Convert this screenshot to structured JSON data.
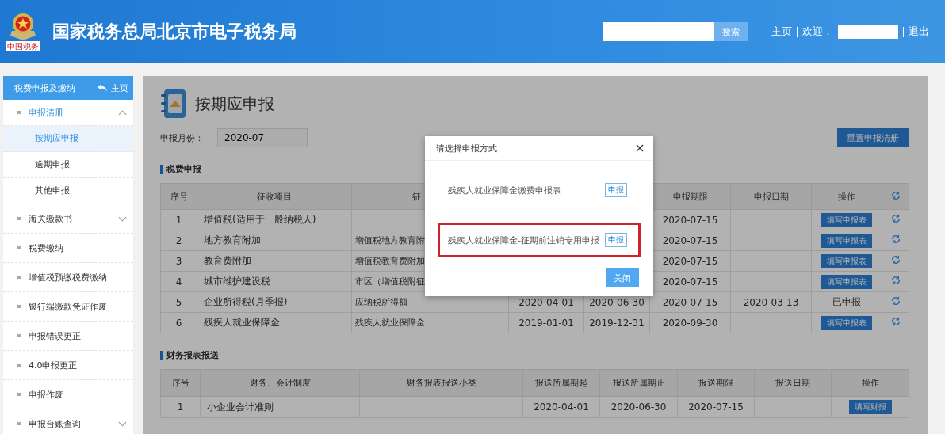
{
  "header": {
    "title": "国家税务总局北京市电子税务局",
    "logo_caption": "中国税务",
    "search": {
      "button": "搜索"
    },
    "links": [
      {
        "label": "主页"
      },
      {
        "label": "欢迎，"
      },
      {
        "label": "退出"
      }
    ]
  },
  "sidebar": {
    "title": "税费申报及缴纳",
    "home": "主页",
    "items": [
      {
        "label": "申报清册",
        "kind": "group",
        "expanded": true,
        "children": [
          {
            "label": "按期应申报",
            "selected": true
          },
          {
            "label": "逾期申报",
            "selected": false
          },
          {
            "label": "其他申报",
            "selected": false
          }
        ]
      },
      {
        "label": "海关缴款书",
        "kind": "group",
        "expanded": false
      },
      {
        "label": "税费缴纳",
        "kind": "link"
      },
      {
        "label": "增值税预缴税费缴纳",
        "kind": "link"
      },
      {
        "label": "银行端缴款凭证作废",
        "kind": "link"
      },
      {
        "label": "申报错误更正",
        "kind": "link"
      },
      {
        "label": "4.0申报更正",
        "kind": "link"
      },
      {
        "label": "申报作废",
        "kind": "link"
      },
      {
        "label": "申报台账查询",
        "kind": "group",
        "expanded": false
      }
    ]
  },
  "page": {
    "title": "按期应申报",
    "month_label": "申报月份：",
    "month_value": "2020-07",
    "reset_button": "重置申报清册"
  },
  "tax_section": {
    "title": "税费申报",
    "columns": [
      {
        "label": "序号"
      },
      {
        "label": "征收项目"
      },
      {
        "label": "征"
      },
      {},
      {},
      {
        "label": "申报期限"
      },
      {
        "label": "申报日期"
      },
      {
        "label": "操作"
      },
      {
        "kind": "refresh"
      }
    ],
    "rows": [
      {
        "no": "1",
        "item": "增值税(适用于一般纳税人)",
        "deadline": "2020-07-15",
        "action": {
          "kind": "button",
          "label": "填写申报表"
        }
      },
      {
        "no": "2",
        "item": "地方教育附加",
        "category": "增值税地方教育附",
        "deadline": "2020-07-15",
        "action": {
          "kind": "button",
          "label": "填写申报表"
        }
      },
      {
        "no": "3",
        "item": "教育费附加",
        "category": "增值税教育费附加",
        "deadline": "2020-07-15",
        "action": {
          "kind": "button",
          "label": "填写申报表"
        }
      },
      {
        "no": "4",
        "item": "城市维护建设税",
        "category": "市区（增值税附征",
        "deadline": "2020-07-15",
        "action": {
          "kind": "button",
          "label": "填写申报表"
        }
      },
      {
        "no": "5",
        "item": "企业所得税(月季报)",
        "category": "应纳税所得额",
        "start": "2020-04-01",
        "end": "2020-06-30",
        "deadline": "2020-07-15",
        "date": "2020-03-13",
        "action": {
          "kind": "text",
          "label": "已申报"
        }
      },
      {
        "no": "6",
        "item": "残疾人就业保障金",
        "category": "残疾人就业保障金",
        "start": "2019-01-01",
        "end": "2019-12-31",
        "deadline": "2020-09-30",
        "action": {
          "kind": "button",
          "label": "填写申报表"
        }
      }
    ]
  },
  "finance_section": {
    "title": "财务报表报送",
    "columns": [
      "序号",
      "财务、会计制度",
      "财务报表报送小类",
      "报送所属期起",
      "报送所属期止",
      "报送期限",
      "报送日期",
      "操作"
    ],
    "rows": [
      {
        "no": "1",
        "system": "小企业会计准则",
        "start": "2020-04-01",
        "end": "2020-06-30",
        "deadline": "2020-07-15",
        "action": "填写财报"
      }
    ]
  },
  "dialog": {
    "title": "请选择申报方式",
    "options": [
      {
        "label": "残疾人就业保障金缴费申报表",
        "button": "申报",
        "highlighted": false
      },
      {
        "label": "残疾人就业保障金-征期前注销专用申报",
        "button": "申报",
        "highlighted": true
      }
    ],
    "close_button": "关闭"
  }
}
